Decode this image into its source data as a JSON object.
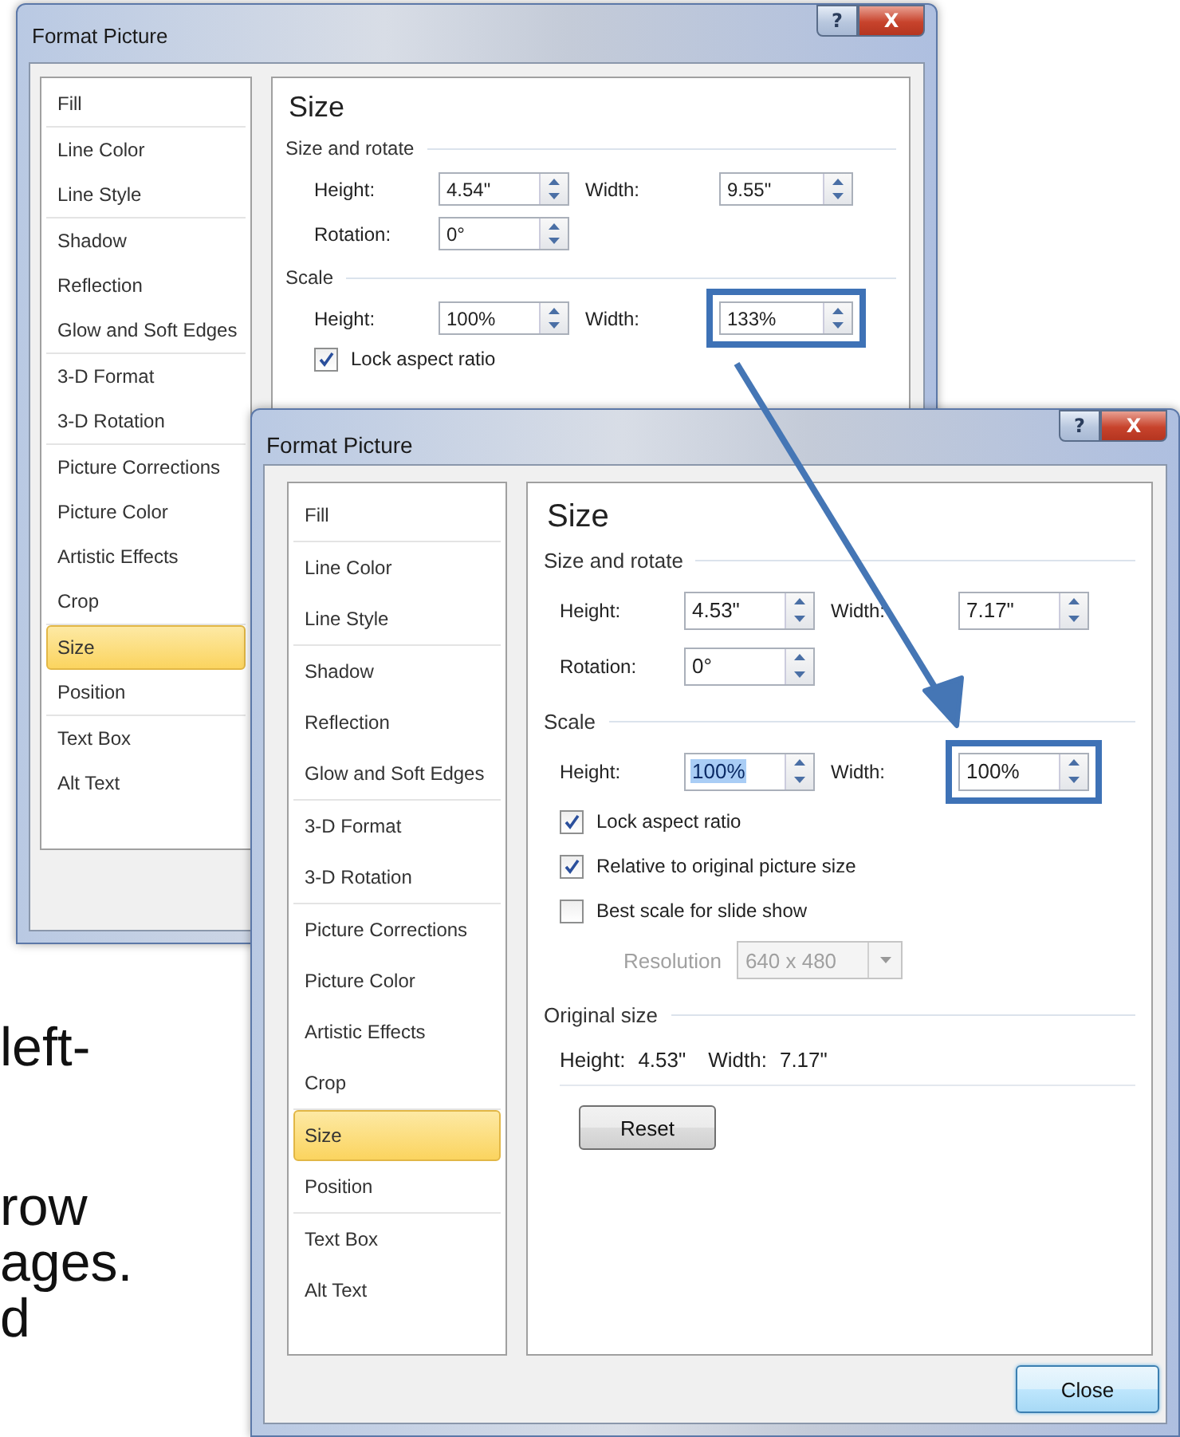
{
  "slide_text": [
    "left-",
    "row",
    "ages.",
    "d"
  ],
  "windows": [
    {
      "title": "Format Picture",
      "help_button": "?",
      "close_button": "X",
      "nav": [
        [
          {
            "label": "Fill",
            "selected": false
          }
        ],
        [
          {
            "label": "Line Color",
            "selected": false
          },
          {
            "label": "Line Style",
            "selected": false
          }
        ],
        [
          {
            "label": "Shadow",
            "selected": false
          },
          {
            "label": "Reflection",
            "selected": false
          },
          {
            "label": "Glow and Soft Edges",
            "selected": false
          }
        ],
        [
          {
            "label": "3-D Format",
            "selected": false
          },
          {
            "label": "3-D Rotation",
            "selected": false
          }
        ],
        [
          {
            "label": "Picture Corrections",
            "selected": false
          },
          {
            "label": "Picture Color",
            "selected": false
          },
          {
            "label": "Artistic Effects",
            "selected": false
          },
          {
            "label": "Crop",
            "selected": false
          }
        ],
        [
          {
            "label": "Size",
            "selected": true
          },
          {
            "label": "Position",
            "selected": false
          }
        ],
        [
          {
            "label": "Text Box",
            "selected": false
          },
          {
            "label": "Alt Text",
            "selected": false
          }
        ]
      ],
      "panel": {
        "heading": "Size",
        "sections": [
          {
            "title": "Size and rotate",
            "rows": [
              {
                "kind": "fields",
                "fields": [
                  {
                    "label": "Height:",
                    "value": "4.54\"",
                    "highlighted": false,
                    "text_selected": false
                  },
                  {
                    "label": "Width:",
                    "value": "9.55\"",
                    "highlighted": false,
                    "text_selected": false
                  }
                ]
              },
              {
                "kind": "fields",
                "fields": [
                  {
                    "label": "Rotation:",
                    "value": "0°",
                    "highlighted": false,
                    "text_selected": false
                  }
                ]
              }
            ]
          },
          {
            "title": "Scale",
            "rows": [
              {
                "kind": "fields",
                "fields": [
                  {
                    "label": "Height:",
                    "value": "100%",
                    "highlighted": false,
                    "text_selected": false
                  },
                  {
                    "label": "Width:",
                    "value": "133%",
                    "highlighted": true,
                    "text_selected": false
                  }
                ]
              },
              {
                "kind": "checkbox",
                "label": "Lock aspect ratio",
                "checked": true
              }
            ]
          }
        ]
      }
    },
    {
      "title": "Format Picture",
      "help_button": "?",
      "close_button": "X",
      "footer_button": "Close",
      "nav": [
        [
          {
            "label": "Fill",
            "selected": false
          }
        ],
        [
          {
            "label": "Line Color",
            "selected": false
          },
          {
            "label": "Line Style",
            "selected": false
          }
        ],
        [
          {
            "label": "Shadow",
            "selected": false
          },
          {
            "label": "Reflection",
            "selected": false
          },
          {
            "label": "Glow and Soft Edges",
            "selected": false
          }
        ],
        [
          {
            "label": "3-D Format",
            "selected": false
          },
          {
            "label": "3-D Rotation",
            "selected": false
          }
        ],
        [
          {
            "label": "Picture Corrections",
            "selected": false
          },
          {
            "label": "Picture Color",
            "selected": false
          },
          {
            "label": "Artistic Effects",
            "selected": false
          },
          {
            "label": "Crop",
            "selected": false
          }
        ],
        [
          {
            "label": "Size",
            "selected": true
          },
          {
            "label": "Position",
            "selected": false
          }
        ],
        [
          {
            "label": "Text Box",
            "selected": false
          },
          {
            "label": "Alt Text",
            "selected": false
          }
        ]
      ],
      "panel": {
        "heading": "Size",
        "sections": [
          {
            "title": "Size and rotate",
            "rows": [
              {
                "kind": "fields",
                "fields": [
                  {
                    "label": "Height:",
                    "value": "4.53\"",
                    "highlighted": false,
                    "text_selected": false
                  },
                  {
                    "label": "Width:",
                    "value": "7.17\"",
                    "highlighted": false,
                    "text_selected": false
                  }
                ]
              },
              {
                "kind": "fields",
                "fields": [
                  {
                    "label": "Rotation:",
                    "value": "0°",
                    "highlighted": false,
                    "text_selected": false
                  }
                ]
              }
            ]
          },
          {
            "title": "Scale",
            "rows": [
              {
                "kind": "fields",
                "fields": [
                  {
                    "label": "Height:",
                    "value": "100%",
                    "highlighted": false,
                    "text_selected": true
                  },
                  {
                    "label": "Width:",
                    "value": "100%",
                    "highlighted": true,
                    "text_selected": false
                  }
                ]
              },
              {
                "kind": "checkbox",
                "label": "Lock aspect ratio",
                "checked": true
              },
              {
                "kind": "checkbox",
                "label": "Relative to original picture size",
                "checked": true
              },
              {
                "kind": "checkbox",
                "label": "Best scale for slide show",
                "checked": false
              },
              {
                "kind": "dropdown",
                "label": "Resolution",
                "value": "640 x 480",
                "disabled": true
              }
            ]
          },
          {
            "title": "Original size",
            "rows": [
              {
                "kind": "info",
                "items": [
                  {
                    "label": "Height:",
                    "value": "4.53\""
                  },
                  {
                    "label": "Width:",
                    "value": "7.17\""
                  }
                ]
              },
              {
                "kind": "button",
                "label": "Reset"
              }
            ]
          }
        ]
      }
    }
  ]
}
